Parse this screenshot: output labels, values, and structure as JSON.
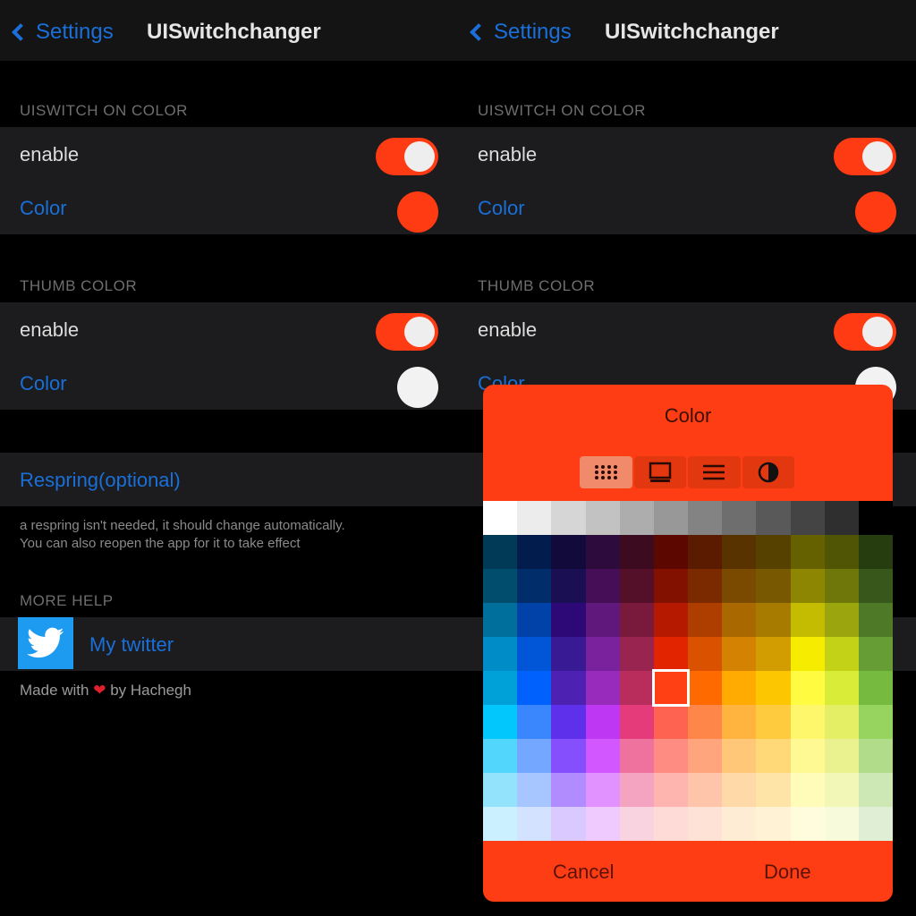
{
  "nav": {
    "back_label": "Settings",
    "title": "UISwitchchanger"
  },
  "sections": {
    "switch_on": {
      "header": "UISWITCH ON COLOR",
      "enable_label": "enable",
      "color_label": "Color",
      "color_value": "#ff3b13",
      "enabled": true
    },
    "thumb": {
      "header": "THUMB COLOR",
      "enable_label": "enable",
      "color_label": "Color",
      "color_value": "#f2f2f2",
      "enabled": true
    }
  },
  "respring": {
    "button_label": "Respring(optional)",
    "note_line1": "a respring isn't needed, it should change automatically.",
    "note_line2": "You can also reopen the app for it to take effect"
  },
  "help": {
    "header": "MORE HELP",
    "twitter_label": "My twitter",
    "footer_prefix": "Made with",
    "footer_heart": "❤",
    "footer_suffix": "by Hachegh"
  },
  "picker": {
    "title": "Color",
    "tabs": [
      "grid-icon",
      "spectrum-icon",
      "sliders-icon",
      "contrast-icon"
    ],
    "active_tab": 0,
    "cancel_label": "Cancel",
    "done_label": "Done",
    "background": "#ff3d14",
    "selected": {
      "row": 5,
      "col": 5
    },
    "grid_rows": [
      [
        "#ffffff",
        "#ececec",
        "#d6d6d6",
        "#c2c2c2",
        "#adadad",
        "#989898",
        "#838383",
        "#6e6e6e",
        "#595959",
        "#444444",
        "#2f2f2f",
        "#000000"
      ],
      [
        "#003a57",
        "#021d4d",
        "#120a3b",
        "#2d0b3d",
        "#3d0b1f",
        "#5c0700",
        "#5a1b00",
        "#583300",
        "#564100",
        "#666100",
        "#4f5504",
        "#263e0f"
      ],
      [
        "#004d6e",
        "#012d6b",
        "#1a0f52",
        "#460e56",
        "#551029",
        "#831100",
        "#7b2a00",
        "#7a4a00",
        "#785800",
        "#8d8602",
        "#6f760a",
        "#38571a"
      ],
      [
        "#006f9b",
        "#0042a8",
        "#2c0977",
        "#61187c",
        "#791a3d",
        "#b51a00",
        "#ad3e00",
        "#a96800",
        "#a67b00",
        "#c4bc00",
        "#9ba50e",
        "#4e7a27"
      ],
      [
        "#008cc7",
        "#0056d6",
        "#371a94",
        "#7a219e",
        "#99244f",
        "#e22400",
        "#da5100",
        "#d38301",
        "#d19d01",
        "#f5ec00",
        "#c3d117",
        "#669d34"
      ],
      [
        "#00a1d8",
        "#0061fd",
        "#4d22b2",
        "#982abc",
        "#b92d5d",
        "#ff4015",
        "#ff6a00",
        "#ffab01",
        "#fcc700",
        "#fefb41",
        "#d9ec37",
        "#76bb40"
      ],
      [
        "#01c7fc",
        "#3a87fd",
        "#5e30eb",
        "#be38f3",
        "#e63b7a",
        "#fe6250",
        "#fe8648",
        "#feb43f",
        "#fecb3e",
        "#fff76b",
        "#e4ef65",
        "#96d35f"
      ],
      [
        "#52d6fc",
        "#74a7ff",
        "#864ffe",
        "#d357fe",
        "#ee719e",
        "#ff8c82",
        "#ffa57d",
        "#ffc777",
        "#ffd977",
        "#fff994",
        "#eaf28f",
        "#b1dd8b"
      ],
      [
        "#93e3fc",
        "#a7c6ff",
        "#b18cfe",
        "#e292fe",
        "#f4a4c0",
        "#ffb5af",
        "#ffc5ab",
        "#ffd9a8",
        "#ffe4a8",
        "#fffbb9",
        "#f2f7b7",
        "#cde8b5"
      ],
      [
        "#cbf0ff",
        "#d3e2ff",
        "#d9c9fe",
        "#efcaff",
        "#f9d3e0",
        "#ffdbd8",
        "#ffe2d6",
        "#ffecd4",
        "#fff2d5",
        "#fefcdd",
        "#f7fadb",
        "#dfeed4"
      ]
    ]
  }
}
